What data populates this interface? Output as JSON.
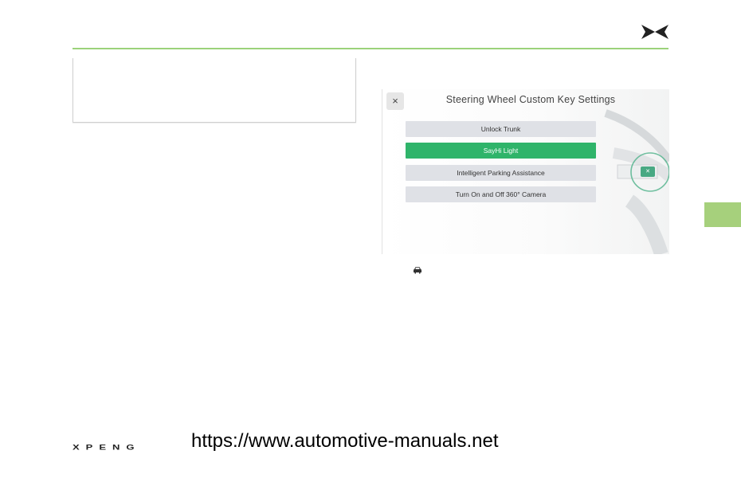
{
  "colors": {
    "accent": "#9bd27a",
    "selected_option": "#2fb46a",
    "side_tab": "#a6d07c"
  },
  "brand": {
    "icon": "xpeng-x-logo-icon"
  },
  "settings_screen": {
    "close_label": "×",
    "title": "Steering Wheel Custom Key Settings",
    "options": [
      {
        "label": "Unlock Trunk",
        "selected": false
      },
      {
        "label": "SayHi Light",
        "selected": true
      },
      {
        "label": "Intelligent Parking Assistance",
        "selected": false
      },
      {
        "label": "Turn On and Off 360° Camera",
        "selected": false
      }
    ],
    "wheel_button_label": "✕"
  },
  "caption": {
    "icon": "car-icon"
  },
  "footer": {
    "logo_text": "XPENG",
    "url": "https://www.automotive-manuals.net"
  }
}
